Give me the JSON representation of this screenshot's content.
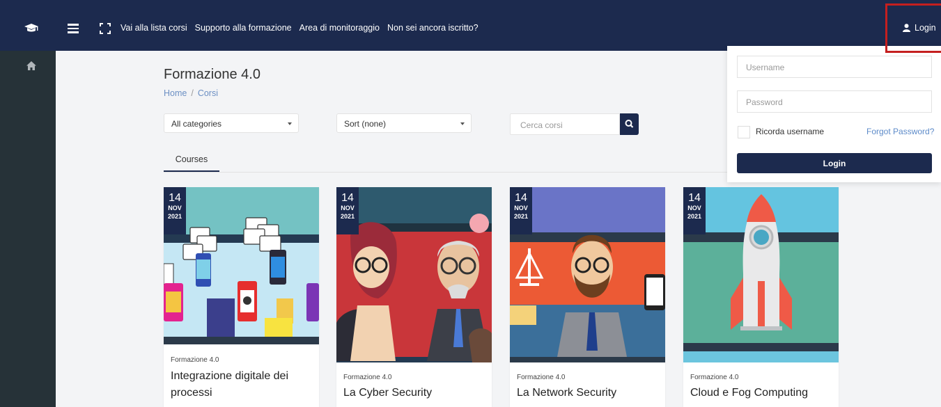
{
  "topbar": {
    "nav": [
      "Vai alla lista corsi",
      "Supporto alla formazione",
      "Area di monitoraggio",
      "Non sei ancora iscritto?"
    ],
    "login_label": "Login"
  },
  "page": {
    "title": "Formazione 4.0",
    "breadcrumb": [
      "Home",
      "Corsi"
    ]
  },
  "filters": {
    "category": "All categories",
    "sort": "Sort (none)",
    "search_placeholder": "Cerca corsi"
  },
  "tabs": [
    "Courses"
  ],
  "courses": [
    {
      "day": "14",
      "month": "NOV",
      "year": "2021",
      "category": "Formazione 4.0",
      "title": "Integrazione digitale dei processi"
    },
    {
      "day": "14",
      "month": "NOV",
      "year": "2021",
      "category": "Formazione 4.0",
      "title": "La Cyber Security"
    },
    {
      "day": "14",
      "month": "NOV",
      "year": "2021",
      "category": "Formazione 4.0",
      "title": "La Network Security"
    },
    {
      "day": "14",
      "month": "NOV",
      "year": "2021",
      "category": "Formazione 4.0",
      "title": "Cloud e Fog Computing"
    }
  ],
  "login_form": {
    "username_placeholder": "Username",
    "password_placeholder": "Password",
    "remember_label": "Ricorda username",
    "forgot_label": "Forgot Password?",
    "submit_label": "Login"
  },
  "colors": {
    "primary": "#1c2a4e",
    "sidebar": "#263238",
    "link": "#6b8fc3",
    "highlight": "#c41f1f"
  }
}
